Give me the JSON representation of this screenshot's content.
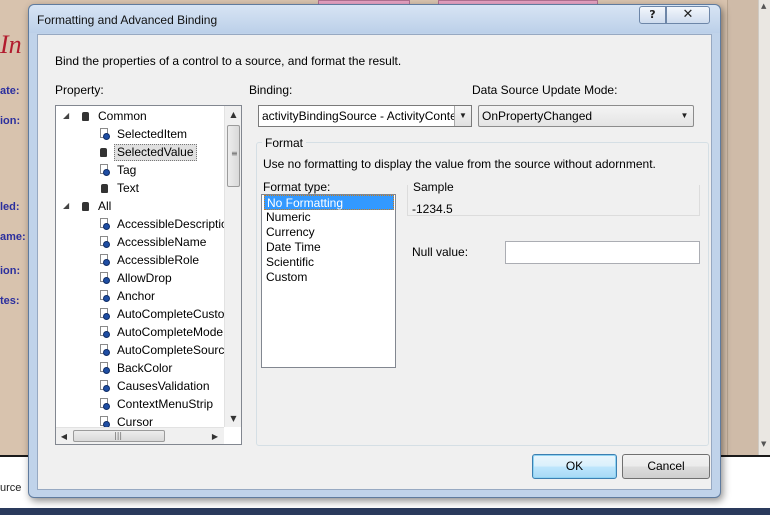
{
  "background": {
    "labels": [
      "ate:",
      "ion:",
      "led:",
      "ame:",
      "ion:",
      "tes:"
    ],
    "title_fragment": "In",
    "bottom_label": "urce"
  },
  "dialog": {
    "title": "Formatting and Advanced Binding",
    "help_glyph": "?",
    "close_glyph": "✕",
    "description": "Bind the properties of a control to a source, and format the result.",
    "property_label": "Property:",
    "binding_label": "Binding:",
    "update_mode_label": "Data Source Update Mode:",
    "binding_value": "activityBindingSource - ActivityContext",
    "update_mode_value": "OnPropertyChanged",
    "tree": {
      "common_label": "Common",
      "common_items": [
        "SelectedItem",
        "SelectedValue",
        "Tag",
        "Text"
      ],
      "all_label": "All",
      "all_items": [
        "AccessibleDescription",
        "AccessibleName",
        "AccessibleRole",
        "AllowDrop",
        "Anchor",
        "AutoCompleteCustomSource",
        "AutoCompleteMode",
        "AutoCompleteSource",
        "BackColor",
        "CausesValidation",
        "ContextMenuStrip",
        "Cursor"
      ],
      "selected_item": "SelectedValue"
    },
    "format": {
      "group_label": "Format",
      "description": "Use no formatting to display the value from the source without adornment.",
      "type_label": "Format type:",
      "types": [
        "No Formatting",
        "Numeric",
        "Currency",
        "Date Time",
        "Scientific",
        "Custom"
      ],
      "selected_type": "No Formatting",
      "sample_label": "Sample",
      "sample_value": "-1234.5",
      "null_label": "Null value:",
      "null_value": ""
    },
    "ok_label": "OK",
    "cancel_label": "Cancel"
  }
}
